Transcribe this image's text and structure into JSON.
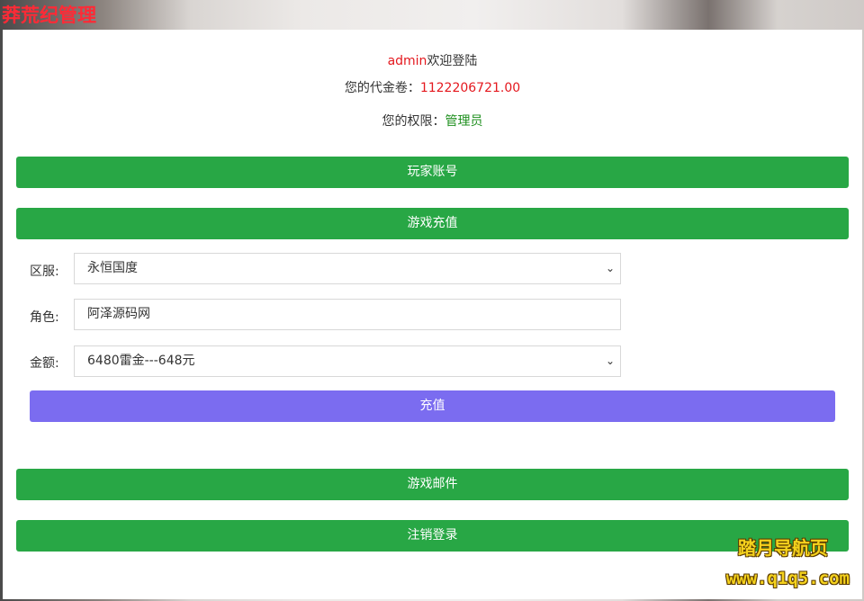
{
  "site": {
    "title": "莽荒纪管理"
  },
  "welcome": {
    "username": "admin",
    "greeting": "欢迎登陆",
    "voucher_label": "您的代金卷：",
    "voucher_value": "1122206721.00",
    "role_label": "您的权限：",
    "role_value": "管理员"
  },
  "menu": {
    "players": "玩家账号",
    "recharge": "游戏充值",
    "mail": "游戏邮件",
    "logout": "注销登录"
  },
  "form": {
    "server_label": "区服:",
    "server_value": "永恒国度",
    "role_label": "角色:",
    "role_value": "阿泽源码网",
    "amount_label": "金额:",
    "amount_value": "6480雷金---648元",
    "submit_label": "充值"
  },
  "watermark": {
    "line1": "踏月导航页",
    "line2": "www.q1q5.com"
  }
}
